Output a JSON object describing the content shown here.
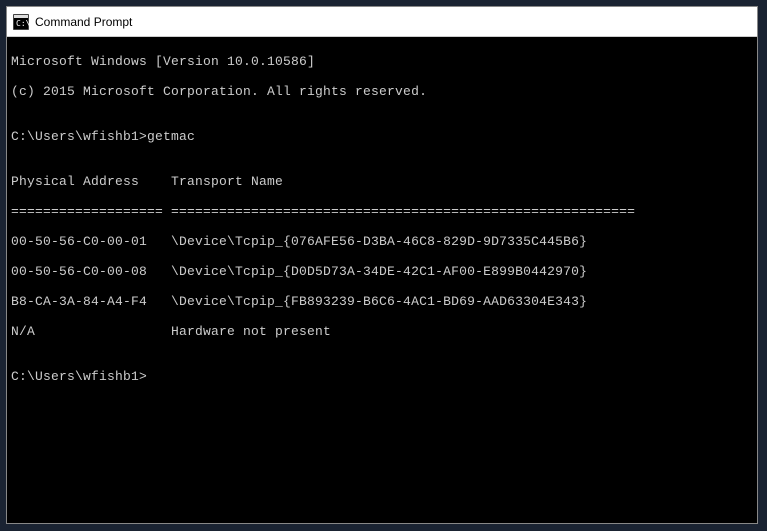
{
  "window": {
    "title": "Command Prompt"
  },
  "terminal": {
    "header1": "Microsoft Windows [Version 10.0.10586]",
    "header2": "(c) 2015 Microsoft Corporation. All rights reserved.",
    "blank": "",
    "prompt1": "C:\\Users\\wfishb1>getmac",
    "colheader": "Physical Address    Transport Name",
    "separator": "=================== ==========================================================",
    "row1": "00-50-56-C0-00-01   \\Device\\Tcpip_{076AFE56-D3BA-46C8-829D-9D7335C445B6}",
    "row2": "00-50-56-C0-00-08   \\Device\\Tcpip_{D0D5D73A-34DE-42C1-AF00-E899B0442970}",
    "row3": "B8-CA-3A-84-A4-F4   \\Device\\Tcpip_{FB893239-B6C6-4AC1-BD69-AAD63304E343}",
    "row4": "N/A                 Hardware not present",
    "prompt2": "C:\\Users\\wfishb1>"
  }
}
